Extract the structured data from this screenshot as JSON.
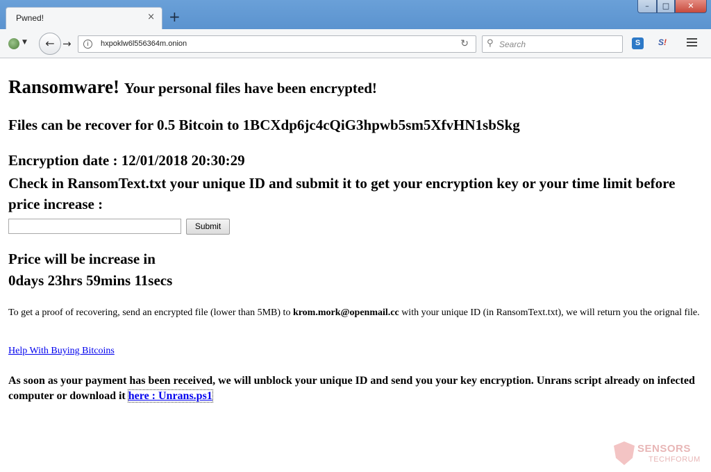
{
  "browser": {
    "tab_title": "Pwned!",
    "tab_close": "×",
    "new_tab": "+",
    "window_controls": {
      "minimize": "–",
      "maximize": "□",
      "close": "✕"
    },
    "url": "hxpoklw6l556364m.onion",
    "search_placeholder": "Search",
    "extensions": [
      "S",
      "S!"
    ]
  },
  "page": {
    "title_main": "Ransomware!",
    "title_sub": "Your personal files have been encrypted!",
    "bitcoin_line": "Files can be recover for 0.5 Bitcoin to 1BCXdp6jc4cQiG3hpwb5sm5XfvHN1sbSkg",
    "encryption_date": "Encryption date : 12/01/2018 20:30:29",
    "check_instructions": "Check in RansomText.txt your unique ID and submit it to get your encryption key or your time limit before price increase :",
    "id_input_value": "",
    "submit_label": "Submit",
    "price_heading": "Price will be increase in",
    "countdown": "0days 23hrs 59mins 11secs",
    "proof_before": "To get a proof of recovering, send an encrypted file (lower than 5MB) to ",
    "proof_email": "krom.mork@openmail.cc",
    "proof_after": " with your unique ID (in RansomText.txt), we will return you the orignal file.",
    "help_link": "Help With Buying Bitcoins",
    "payment_text": "As soon as your payment has been received, we will unblock your unique ID and send you your key encryption. Unrans script already on infected computer or download it ",
    "here_link": "here : Unrans.ps1"
  },
  "watermark": {
    "line1": "SENSORS",
    "line2": "TECHFORUM"
  }
}
